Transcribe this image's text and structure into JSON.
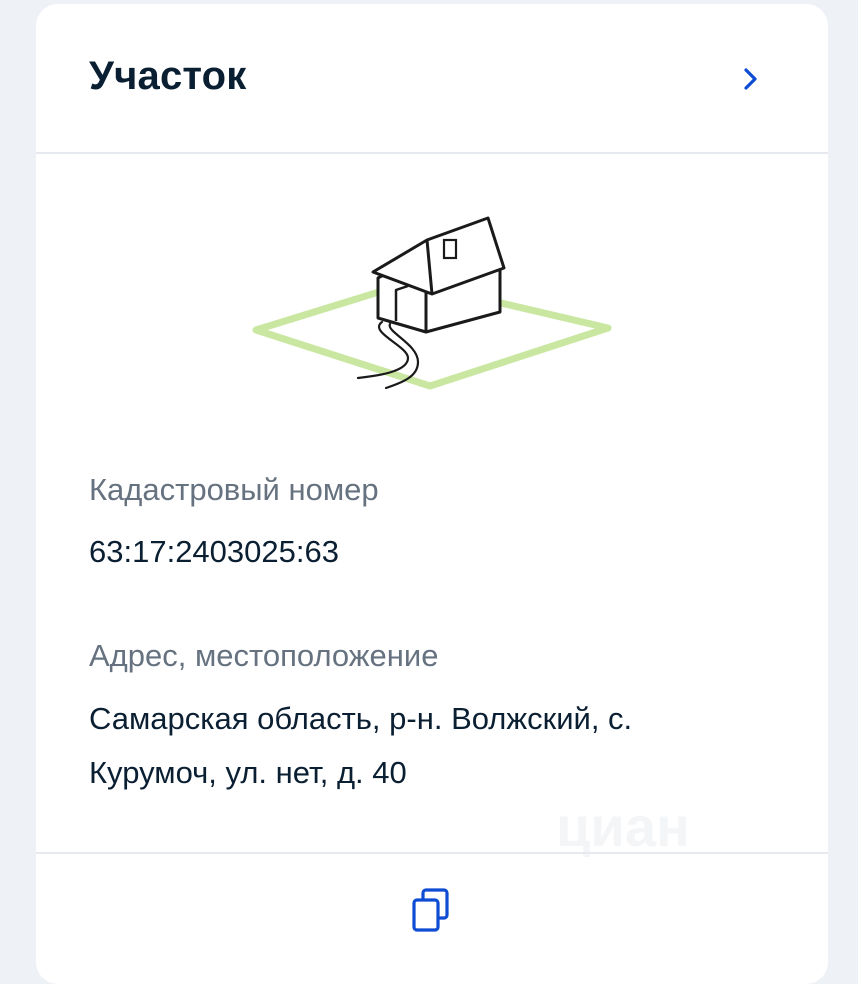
{
  "card": {
    "title": "Участок",
    "cadastral": {
      "label": "Кадастровый номер",
      "value": "63:17:2403025:63"
    },
    "address": {
      "label": "Адрес, местоположение",
      "line1": "Самарская область, р-н. Волжский, с.",
      "line2": "Курумоч, ул. нет, д. 40"
    }
  },
  "icons": {
    "header_action": "chevron-right-icon",
    "footer_action": "copy-icon",
    "illustration": "house-plot-illustration"
  },
  "watermark": "циан",
  "colors": {
    "title": "#0b1f33",
    "label": "#66727f",
    "accent": "#0d4cd3",
    "plot_green": "#c9e7a0"
  }
}
